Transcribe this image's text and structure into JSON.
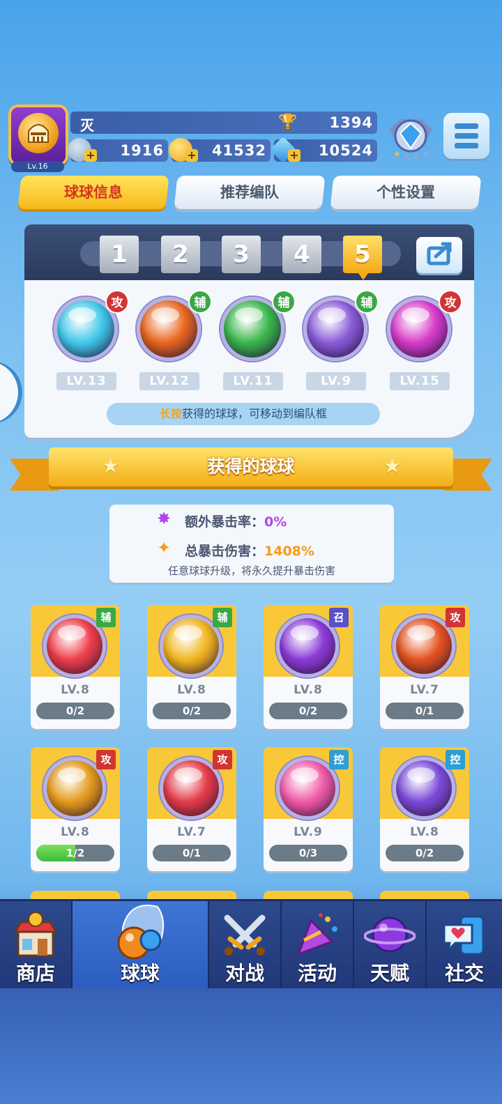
{
  "player": {
    "name": "灭",
    "level": "Lv.16",
    "trophies": "1394",
    "currency_a": "1916",
    "coins": "41532",
    "diamonds": "10524"
  },
  "tabs": [
    {
      "label": "球球信息",
      "active": true
    },
    {
      "label": "推荐编队",
      "active": false
    },
    {
      "label": "个性设置",
      "active": false
    }
  ],
  "team_slots": [
    "1",
    "2",
    "3",
    "4",
    "5"
  ],
  "active_slot": "5",
  "team": [
    {
      "role": "攻",
      "level": "LV.13",
      "color": "#3fc8e8",
      "icon": "sword-emblem-icon"
    },
    {
      "role": "辅",
      "level": "LV.12",
      "color": "#e8651c",
      "icon": "wings-emblem-icon"
    },
    {
      "role": "辅",
      "level": "LV.11",
      "color": "#38b64a",
      "icon": "arrow-up-emblem-icon"
    },
    {
      "role": "辅",
      "level": "LV.9",
      "color": "#8a5ad8",
      "icon": "clone-emblem-icon"
    },
    {
      "role": "攻",
      "level": "LV.15",
      "color": "#d63ac8",
      "icon": "shield-emblem-icon"
    }
  ],
  "hint": {
    "highlight": "长按",
    "text": "获得的球球，可移动到编队框"
  },
  "section_title": "获得的球球",
  "crit": {
    "extra_label": "额外暴击率：",
    "extra_value": "0%",
    "total_label": "总暴击伤害：",
    "total_value": "1408%",
    "note": "任意球球升级，将永久提升暴击伤害"
  },
  "owned_balls": [
    {
      "role": "辅",
      "level": "LV.8",
      "progress": "0/2",
      "fraction": 0,
      "color": "#ee3d4a",
      "icon": "gift-emblem-icon"
    },
    {
      "role": "辅",
      "level": "LV.8",
      "progress": "0/2",
      "fraction": 0,
      "color": "#f2b620",
      "icon": "piggy-bank-emblem-icon"
    },
    {
      "role": "召",
      "level": "LV.8",
      "progress": "0/2",
      "fraction": 0,
      "color": "#8a3ad8",
      "icon": "phoenix-emblem-icon"
    },
    {
      "role": "攻",
      "level": "LV.7",
      "progress": "0/1",
      "fraction": 0,
      "color": "#e45220",
      "icon": "scroll-emblem-icon"
    },
    {
      "role": "攻",
      "level": "LV.8",
      "progress": "1/2",
      "fraction": 0.5,
      "color": "#e49a1a",
      "icon": "helmet-emblem-icon"
    },
    {
      "role": "攻",
      "level": "LV.7",
      "progress": "0/1",
      "fraction": 0,
      "color": "#e33b48",
      "icon": "yin-yang-emblem-icon"
    },
    {
      "role": "控",
      "level": "LV.9",
      "progress": "0/3",
      "fraction": 0,
      "color": "#f05aa8",
      "icon": "heart-emblem-icon"
    },
    {
      "role": "控",
      "level": "LV.8",
      "progress": "0/2",
      "fraction": 0,
      "color": "#7a4ad8",
      "icon": "butterfly-emblem-icon"
    }
  ],
  "bottom_nav": [
    {
      "label": "商店",
      "icon": "shop-icon",
      "active": false
    },
    {
      "label": "球球",
      "icon": "balls-icon",
      "active": true
    },
    {
      "label": "对战",
      "icon": "crossed-swords-icon",
      "active": false
    },
    {
      "label": "活动",
      "icon": "party-popper-icon",
      "active": false
    },
    {
      "label": "天赋",
      "icon": "planet-icon",
      "active": false
    },
    {
      "label": "社交",
      "icon": "chat-phone-icon",
      "active": false
    }
  ],
  "colors": {
    "tab_active": "#f7b91b",
    "attack": "#d23434",
    "support": "#3aa844",
    "summon": "#5a50c8",
    "control": "#2b9fd6"
  }
}
